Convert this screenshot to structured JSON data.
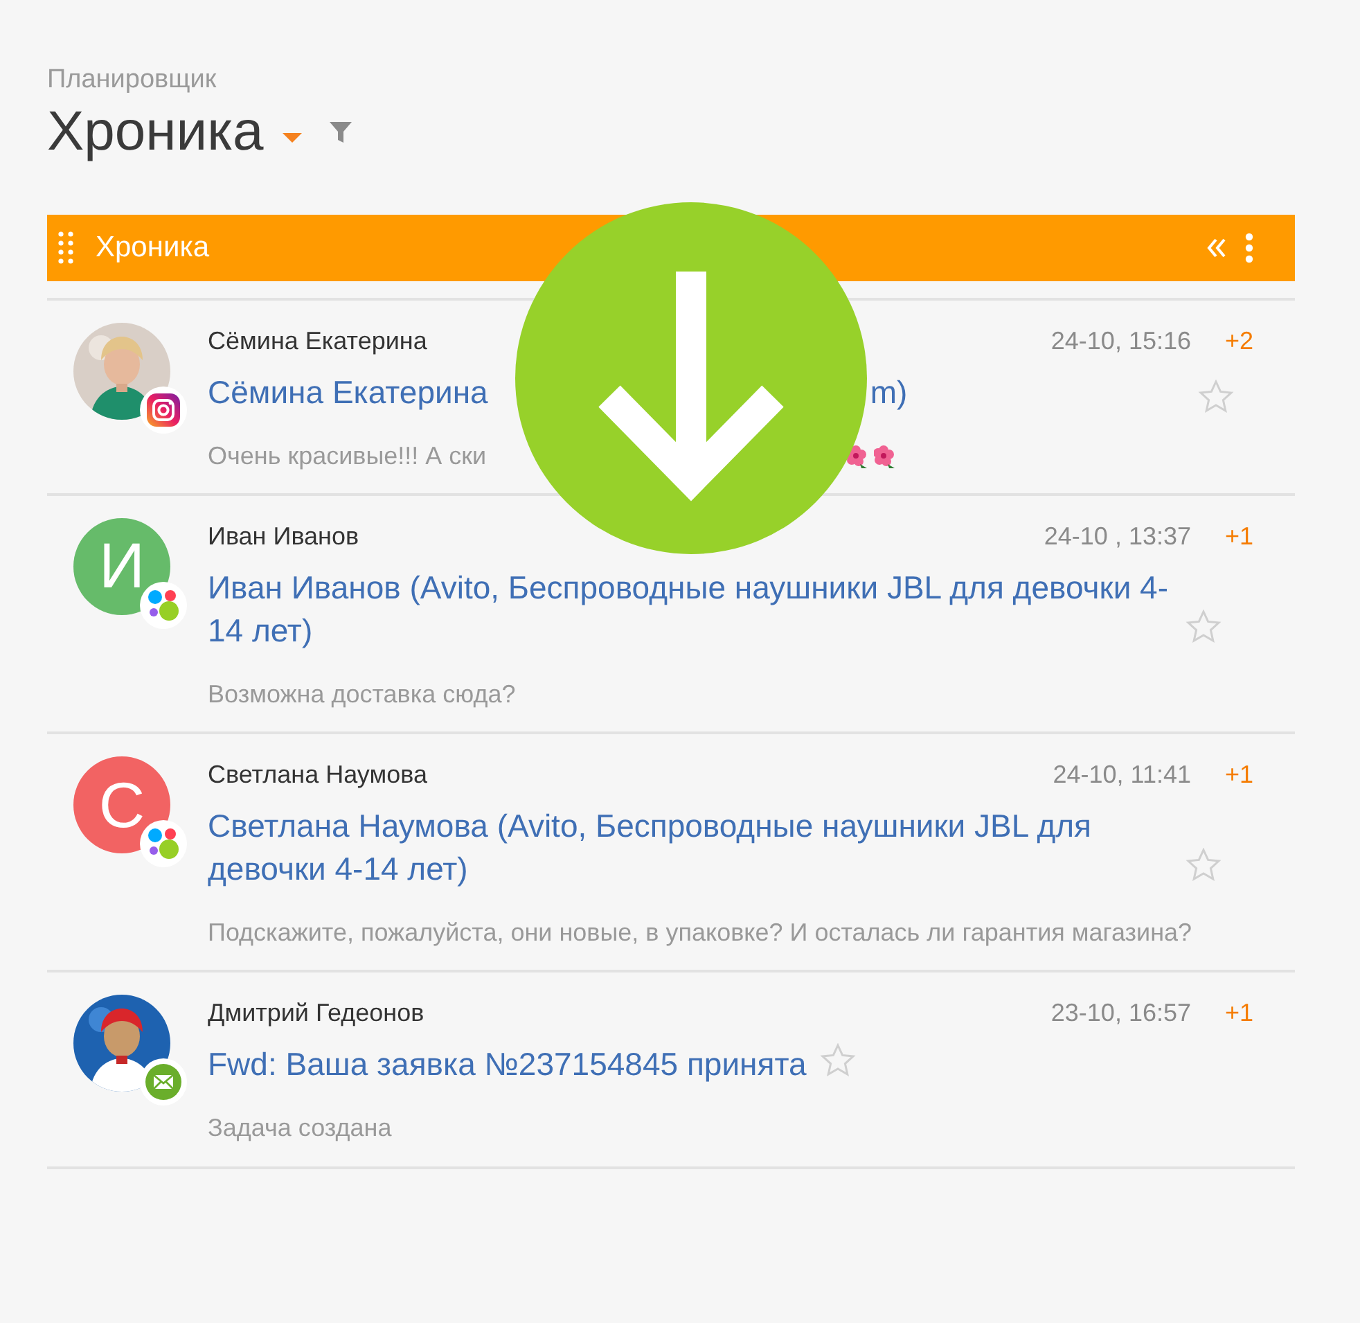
{
  "header": {
    "subtitle": "Планировщик",
    "title": "Хроника"
  },
  "panel": {
    "title": "Хроника"
  },
  "items": [
    {
      "author": "Сёмина Екатерина",
      "date": "24-10, 15:16",
      "count": "+2",
      "title_parts": [
        "Сёмина Екатерина",
        "m)"
      ],
      "message_parts": [
        "Очень красивые!!! А ски"
      ],
      "message_icons": [
        {
          "kind": "flower"
        },
        {
          "kind": "flower"
        }
      ],
      "avatar": {
        "kind": "picture"
      },
      "badge": {
        "kind": "instagram"
      },
      "starred": false
    },
    {
      "author": "Иван Иванов",
      "date": "24-10 , 13:37",
      "count": "+1",
      "title_parts": [
        "Иван Иванов (Avito, Беспроводные наушники JBL для девочки 4-14 лет)"
      ],
      "message_parts": [
        "Возможна доставка сюда?"
      ],
      "avatar": {
        "kind": "letter",
        "letter": "И",
        "color": "#66bb6a"
      },
      "badge": {
        "kind": "avito"
      },
      "starred": false
    },
    {
      "author": "Светлана Наумова",
      "date": "24-10, 11:41",
      "count": "+1",
      "title_parts": [
        "Светлана Наумова (Avito, Беспроводные наушники JBL для девочки 4-14 лет)"
      ],
      "message_parts": [
        "Подскажите, пожалуйста, они новые, в упаковке? И осталась ли гарантия магазина?"
      ],
      "avatar": {
        "kind": "letter",
        "letter": "С",
        "color": "#f26363"
      },
      "badge": {
        "kind": "avito"
      },
      "starred": false
    },
    {
      "author": "Дмитрий Гедеонов",
      "date": "23-10, 16:57",
      "count": "+1",
      "title_parts": [
        "Fwd: Ваша заявка №237154845 принята"
      ],
      "message_parts": [
        "Задача создана"
      ],
      "avatar": {
        "kind": "picture"
      },
      "badge": {
        "kind": "email"
      },
      "starred": false
    }
  ],
  "overlay": {
    "kind": "download"
  }
}
